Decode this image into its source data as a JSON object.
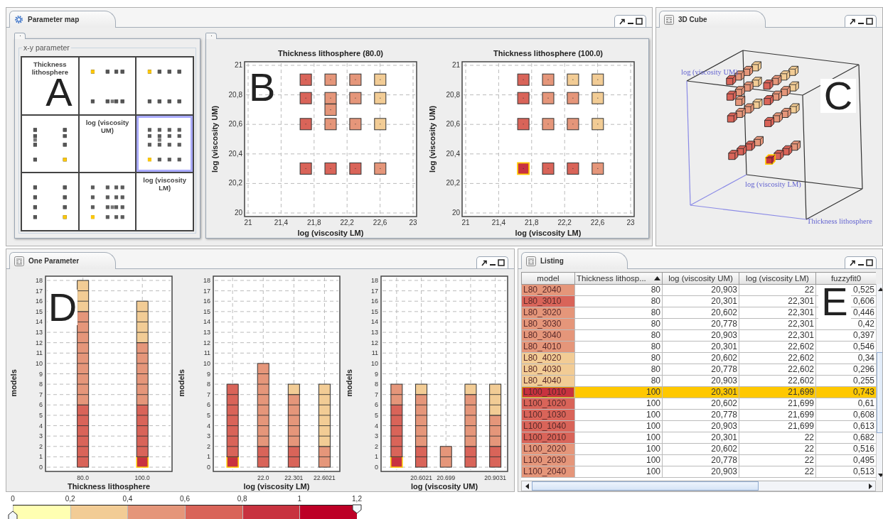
{
  "parameter_map": {
    "title": "Parameter map",
    "matrix": {
      "title": "x-y parameter",
      "overlay_label": "A",
      "cells": [
        {
          "kind": "label",
          "text": "Thickness lithosphere",
          "selected": false
        },
        {
          "kind": "plot",
          "selected": false
        },
        {
          "kind": "plot",
          "selected": false
        },
        {
          "kind": "plot",
          "selected": false
        },
        {
          "kind": "label",
          "text": "log (viscosity UM)",
          "selected": false
        },
        {
          "kind": "plot",
          "selected": true
        },
        {
          "kind": "plot",
          "selected": false
        },
        {
          "kind": "plot",
          "selected": false
        },
        {
          "kind": "label",
          "text": "log (viscosity LM)",
          "selected": false
        }
      ]
    },
    "scatter": {
      "overlay_label": "B",
      "plots": [
        {
          "first_series_selected": false,
          "chart_data": {
            "type": "scatter",
            "grid": true,
            "title": "Thickness lithosphere (80.0)",
            "xlabel": "log (viscosity LM)",
            "ylabel": "log (viscosity UM)",
            "xlim": [
              21,
              23
            ],
            "ylim": [
              20,
              21
            ],
            "xticks": [
              {
                "value": 21,
                "label": "21"
              },
              {
                "value": 21.4,
                "label": "21,4"
              },
              {
                "value": 21.8,
                "label": "21,8"
              },
              {
                "value": 22.2,
                "label": "22,2"
              },
              {
                "value": 22.6,
                "label": "22,6"
              },
              {
                "value": 23,
                "label": "23"
              }
            ],
            "yticks": [
              {
                "value": 20,
                "label": "20"
              },
              {
                "value": 20.2,
                "label": "20,2"
              },
              {
                "value": 20.4,
                "label": "20,4"
              },
              {
                "value": 20.6,
                "label": "20,6"
              },
              {
                "value": 20.8,
                "label": "20,8"
              },
              {
                "value": 21,
                "label": "21"
              }
            ],
            "series": [
              {
                "color": "#d96459",
                "x": [
                  21.699,
                  21.699,
                  21.699,
                  21.699,
                  22,
                  22.301
                ],
                "values": [
                  20.903,
                  20.778,
                  20.602,
                  20.301,
                  20.301,
                  20.301
                ]
              },
              {
                "color": "#e5967a",
                "x": [
                  22,
                  22.301,
                  22,
                  22.301,
                  22,
                  22,
                  22.301,
                  22.602
                ],
                "values": [
                  20.903,
                  20.903,
                  20.778,
                  20.778,
                  20.699,
                  20.602,
                  20.602,
                  20.301
                ]
              },
              {
                "color": "#f2cc95",
                "x": [
                  22.602,
                  22.602,
                  22.602
                ],
                "values": [
                  20.903,
                  20.778,
                  20.602
                ]
              }
            ]
          }
        },
        {
          "first_series_selected": true,
          "chart_data": {
            "type": "scatter",
            "grid": true,
            "title": "Thickness lithosphere (100.0)",
            "xlabel": "log (viscosity LM)",
            "ylabel": "log (viscosity UM)",
            "xlim": [
              21,
              23
            ],
            "ylim": [
              20,
              21
            ],
            "xticks": [
              {
                "value": 21,
                "label": "21"
              },
              {
                "value": 21.4,
                "label": "21,4"
              },
              {
                "value": 21.8,
                "label": "21,8"
              },
              {
                "value": 22.2,
                "label": "22,2"
              },
              {
                "value": 22.6,
                "label": "22,6"
              },
              {
                "value": 23,
                "label": "23"
              }
            ],
            "yticks": [
              {
                "value": 20,
                "label": "20"
              },
              {
                "value": 20.2,
                "label": "20,2"
              },
              {
                "value": 20.4,
                "label": "20,4"
              },
              {
                "value": 20.6,
                "label": "20,6"
              },
              {
                "value": 20.8,
                "label": "20,8"
              },
              {
                "value": 21,
                "label": "21"
              }
            ],
            "series": [
              {
                "color": "#c8323f",
                "x": [
                  21.699
                ],
                "values": [
                  20.301
                ]
              },
              {
                "color": "#d96459",
                "x": [
                  21.699,
                  21.699,
                  21.699,
                  22,
                  22.301
                ],
                "values": [
                  20.903,
                  20.778,
                  20.602,
                  20.301,
                  20.301
                ]
              },
              {
                "color": "#e5967a",
                "x": [
                  22,
                  22,
                  22.301,
                  22,
                  22.301,
                  22.602
                ],
                "values": [
                  20.903,
                  20.778,
                  20.778,
                  20.602,
                  20.602,
                  20.301
                ]
              },
              {
                "color": "#f2cc95",
                "x": [
                  22.301,
                  22.602,
                  22.602,
                  22.602
                ],
                "values": [
                  20.903,
                  20.903,
                  20.778,
                  20.602
                ]
              }
            ]
          }
        }
      ]
    }
  },
  "cube_view": {
    "title": "3D Cube",
    "overlay_label": "C",
    "axis_labels": [
      "log (viscosity UM)",
      "log (viscosity LM)",
      "Thickness lithosphere"
    ]
  },
  "one_parameter": {
    "title": "One Parameter",
    "overlay_label": "D",
    "histograms": [
      {
        "first_series_selected": true,
        "chart_data": {
          "type": "bar",
          "stacked": true,
          "grid": true,
          "xlabel": "Thickness lithosphere",
          "ylabel": "models",
          "categories": [
            "80.0",
            "100.0"
          ],
          "ylim": [
            0,
            18
          ],
          "yticks": [
            0,
            1,
            2,
            3,
            4,
            5,
            6,
            7,
            8,
            9,
            10,
            11,
            12,
            13,
            14,
            15,
            16,
            17,
            18
          ],
          "series": [
            {
              "color": "#c8323f",
              "values": [
                0,
                1
              ]
            },
            {
              "color": "#d96459",
              "values": [
                6,
                5
              ]
            },
            {
              "color": "#e5967a",
              "values": [
                9,
                6
              ]
            },
            {
              "color": "#f2cc95",
              "values": [
                3,
                4
              ]
            }
          ]
        }
      },
      {
        "first_series_selected": true,
        "chart_data": {
          "type": "bar",
          "stacked": true,
          "grid": true,
          "xlabel": "log (viscosity LM)",
          "ylabel": "models",
          "categories": [
            null,
            "22.0",
            "22.301",
            "22.6021"
          ],
          "ylim": [
            0,
            18
          ],
          "yticks": [
            0,
            1,
            2,
            3,
            4,
            5,
            6,
            7,
            8,
            9,
            10,
            11,
            12,
            13,
            14,
            15,
            16,
            17,
            18
          ],
          "series": [
            {
              "color": "#c8323f",
              "values": [
                1,
                0,
                0,
                0
              ]
            },
            {
              "color": "#d96459",
              "values": [
                7,
                2,
                2,
                0
              ]
            },
            {
              "color": "#e5967a",
              "values": [
                0,
                8,
                5,
                2
              ]
            },
            {
              "color": "#f2cc95",
              "values": [
                0,
                0,
                1,
                6
              ]
            }
          ]
        }
      },
      {
        "first_series_selected": true,
        "chart_data": {
          "type": "bar",
          "stacked": true,
          "grid": true,
          "xlabel": "log (viscosity UM)",
          "ylabel": "models",
          "categories": [
            null,
            "20.6021",
            "20.699",
            null,
            "20.9031"
          ],
          "ylim": [
            0,
            18
          ],
          "yticks": [
            0,
            1,
            2,
            3,
            4,
            5,
            6,
            7,
            8,
            9,
            10,
            11,
            12,
            13,
            14,
            15,
            16,
            17,
            18
          ],
          "series": [
            {
              "color": "#c8323f",
              "values": [
                1,
                0,
                0,
                0,
                0
              ]
            },
            {
              "color": "#d96459",
              "values": [
                5,
                2,
                0,
                2,
                2
              ]
            },
            {
              "color": "#e5967a",
              "values": [
                2,
                5,
                2,
                5,
                3
              ]
            },
            {
              "color": "#f2cc95",
              "values": [
                0,
                1,
                0,
                1,
                3
              ]
            }
          ]
        }
      }
    ]
  },
  "listing": {
    "title": "Listing",
    "overlay_label": "E",
    "columns": [
      {
        "label": "model",
        "sorted": false
      },
      {
        "label": "Thickness lithosp...",
        "sorted": true
      },
      {
        "label": "log (viscosity UM)",
        "sorted": false
      },
      {
        "label": "log (viscosity LM)",
        "sorted": false
      },
      {
        "label": "fuzzyfit0",
        "sorted": false
      }
    ],
    "rows": [
      {
        "model": "L80_2040",
        "color": "#e5967a",
        "thickness": "80",
        "um": "20,903",
        "lm": "22",
        "fuzzyfit0": "0,525",
        "selected": false
      },
      {
        "model": "L80_3010",
        "color": "#d96459",
        "thickness": "80",
        "um": "20,301",
        "lm": "22,301",
        "fuzzyfit0": "0,606",
        "selected": false
      },
      {
        "model": "L80_3020",
        "color": "#e5967a",
        "thickness": "80",
        "um": "20,602",
        "lm": "22,301",
        "fuzzyfit0": "0,446",
        "selected": false
      },
      {
        "model": "L80_3030",
        "color": "#e5967a",
        "thickness": "80",
        "um": "20,778",
        "lm": "22,301",
        "fuzzyfit0": "0,42",
        "selected": false
      },
      {
        "model": "L80_3040",
        "color": "#e5967a",
        "thickness": "80",
        "um": "20,903",
        "lm": "22,301",
        "fuzzyfit0": "0,397",
        "selected": false
      },
      {
        "model": "L80_4010",
        "color": "#e5967a",
        "thickness": "80",
        "um": "20,301",
        "lm": "22,602",
        "fuzzyfit0": "0,546",
        "selected": false
      },
      {
        "model": "L80_4020",
        "color": "#f2cc95",
        "thickness": "80",
        "um": "20,602",
        "lm": "22,602",
        "fuzzyfit0": "0,34",
        "selected": false
      },
      {
        "model": "L80_4030",
        "color": "#f2cc95",
        "thickness": "80",
        "um": "20,778",
        "lm": "22,602",
        "fuzzyfit0": "0,296",
        "selected": false
      },
      {
        "model": "L80_4040",
        "color": "#f2cc95",
        "thickness": "80",
        "um": "20,903",
        "lm": "22,602",
        "fuzzyfit0": "0,255",
        "selected": false
      },
      {
        "model": "L100_1010",
        "color": "#c8323f",
        "thickness": "100",
        "um": "20,301",
        "lm": "21,699",
        "fuzzyfit0": "0,743",
        "selected": true
      },
      {
        "model": "L100_1020",
        "color": "#d96459",
        "thickness": "100",
        "um": "20,602",
        "lm": "21,699",
        "fuzzyfit0": "0,61",
        "selected": false
      },
      {
        "model": "L100_1030",
        "color": "#d96459",
        "thickness": "100",
        "um": "20,778",
        "lm": "21,699",
        "fuzzyfit0": "0,608",
        "selected": false
      },
      {
        "model": "L100_1040",
        "color": "#d96459",
        "thickness": "100",
        "um": "20,903",
        "lm": "21,699",
        "fuzzyfit0": "0,613",
        "selected": false
      },
      {
        "model": "L100_2010",
        "color": "#d96459",
        "thickness": "100",
        "um": "20,301",
        "lm": "22",
        "fuzzyfit0": "0,682",
        "selected": false
      },
      {
        "model": "L100_2020",
        "color": "#e5967a",
        "thickness": "100",
        "um": "20,602",
        "lm": "22",
        "fuzzyfit0": "0,516",
        "selected": false
      },
      {
        "model": "L100_2030",
        "color": "#e5967a",
        "thickness": "100",
        "um": "20,778",
        "lm": "22",
        "fuzzyfit0": "0,495",
        "selected": false
      },
      {
        "model": "L100_2040",
        "color": "#e5967a",
        "thickness": "100",
        "um": "20,903",
        "lm": "22",
        "fuzzyfit0": "0,513",
        "selected": false
      }
    ]
  },
  "color_scale": {
    "ticks": [
      "0",
      "0,2",
      "0,4",
      "0,6",
      "0,8",
      "1",
      "1,2"
    ],
    "segments": [
      {
        "color": "#ffffb2"
      },
      {
        "color": "#f2cc95"
      },
      {
        "color": "#e5967a"
      },
      {
        "color": "#d96459"
      },
      {
        "color": "#c8323f"
      },
      {
        "color": "#bd0026"
      }
    ],
    "low": {
      "level": 0
    },
    "high": {
      "level": 1
    }
  }
}
